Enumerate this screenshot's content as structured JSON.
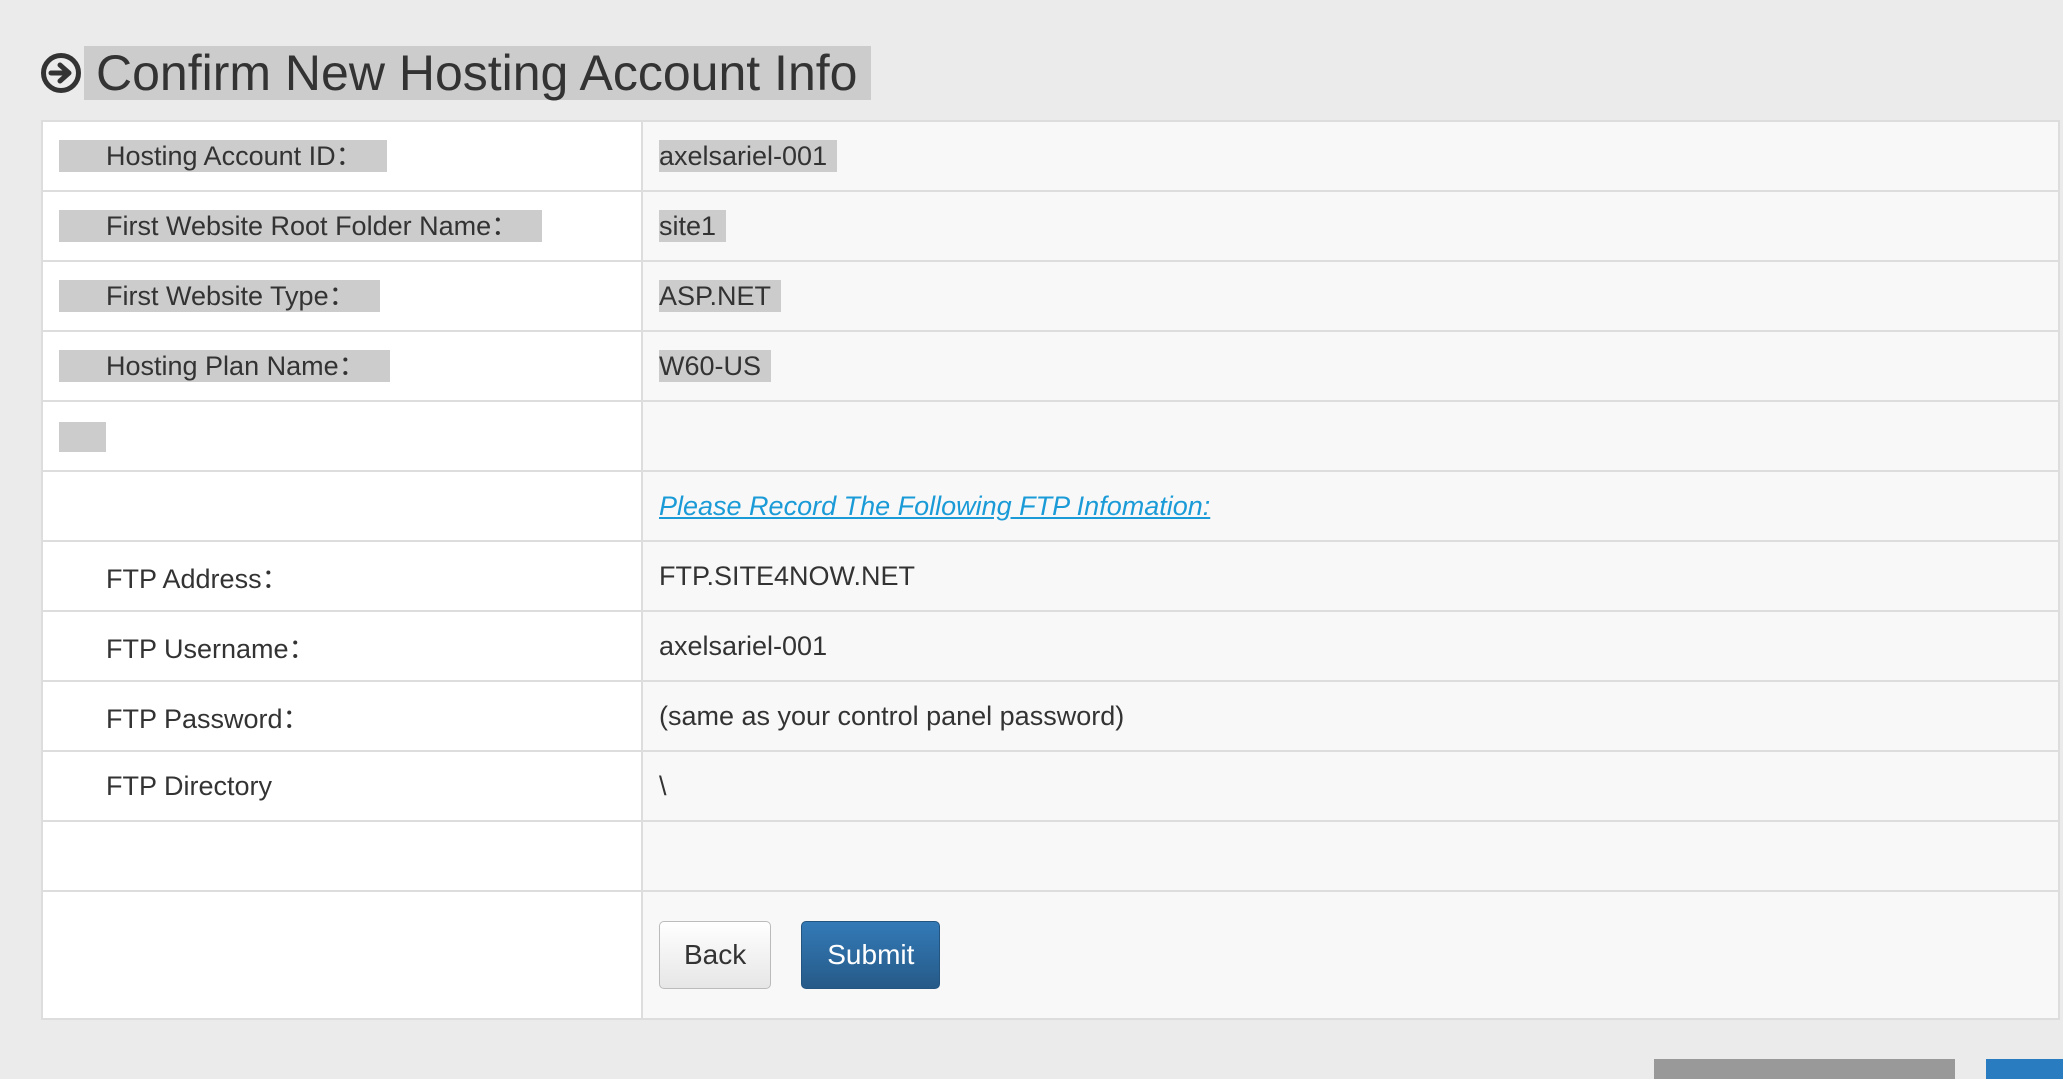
{
  "page": {
    "title": "Confirm New Hosting Account Info",
    "title_icon": "circle-arrow-right-icon"
  },
  "account_rows": [
    {
      "label": "Hosting Account ID：",
      "value": "axelsariel-001"
    },
    {
      "label": "First Website Root Folder Name：",
      "value": "site1"
    },
    {
      "label": "First Website Type：",
      "value": "ASP.NET"
    },
    {
      "label": "Hosting Plan Name：",
      "value": "W60-US"
    }
  ],
  "ftp": {
    "notice": "Please Record The Following FTP Infomation:",
    "rows": [
      {
        "label": "FTP Address：",
        "value": "FTP.SITE4NOW.NET"
      },
      {
        "label": "FTP Username：",
        "value": "axelsariel-001"
      },
      {
        "label": "FTP Password：",
        "value": "(same as your control panel password)"
      },
      {
        "label": "FTP Directory",
        "value": "\\"
      }
    ]
  },
  "actions": {
    "back_label": "Back",
    "submit_label": "Submit"
  },
  "colors": {
    "link": "#1a9bd7",
    "submit_bg": "#2d6ca2",
    "highlight": "#cccccc",
    "page_bg": "#ebebeb"
  }
}
